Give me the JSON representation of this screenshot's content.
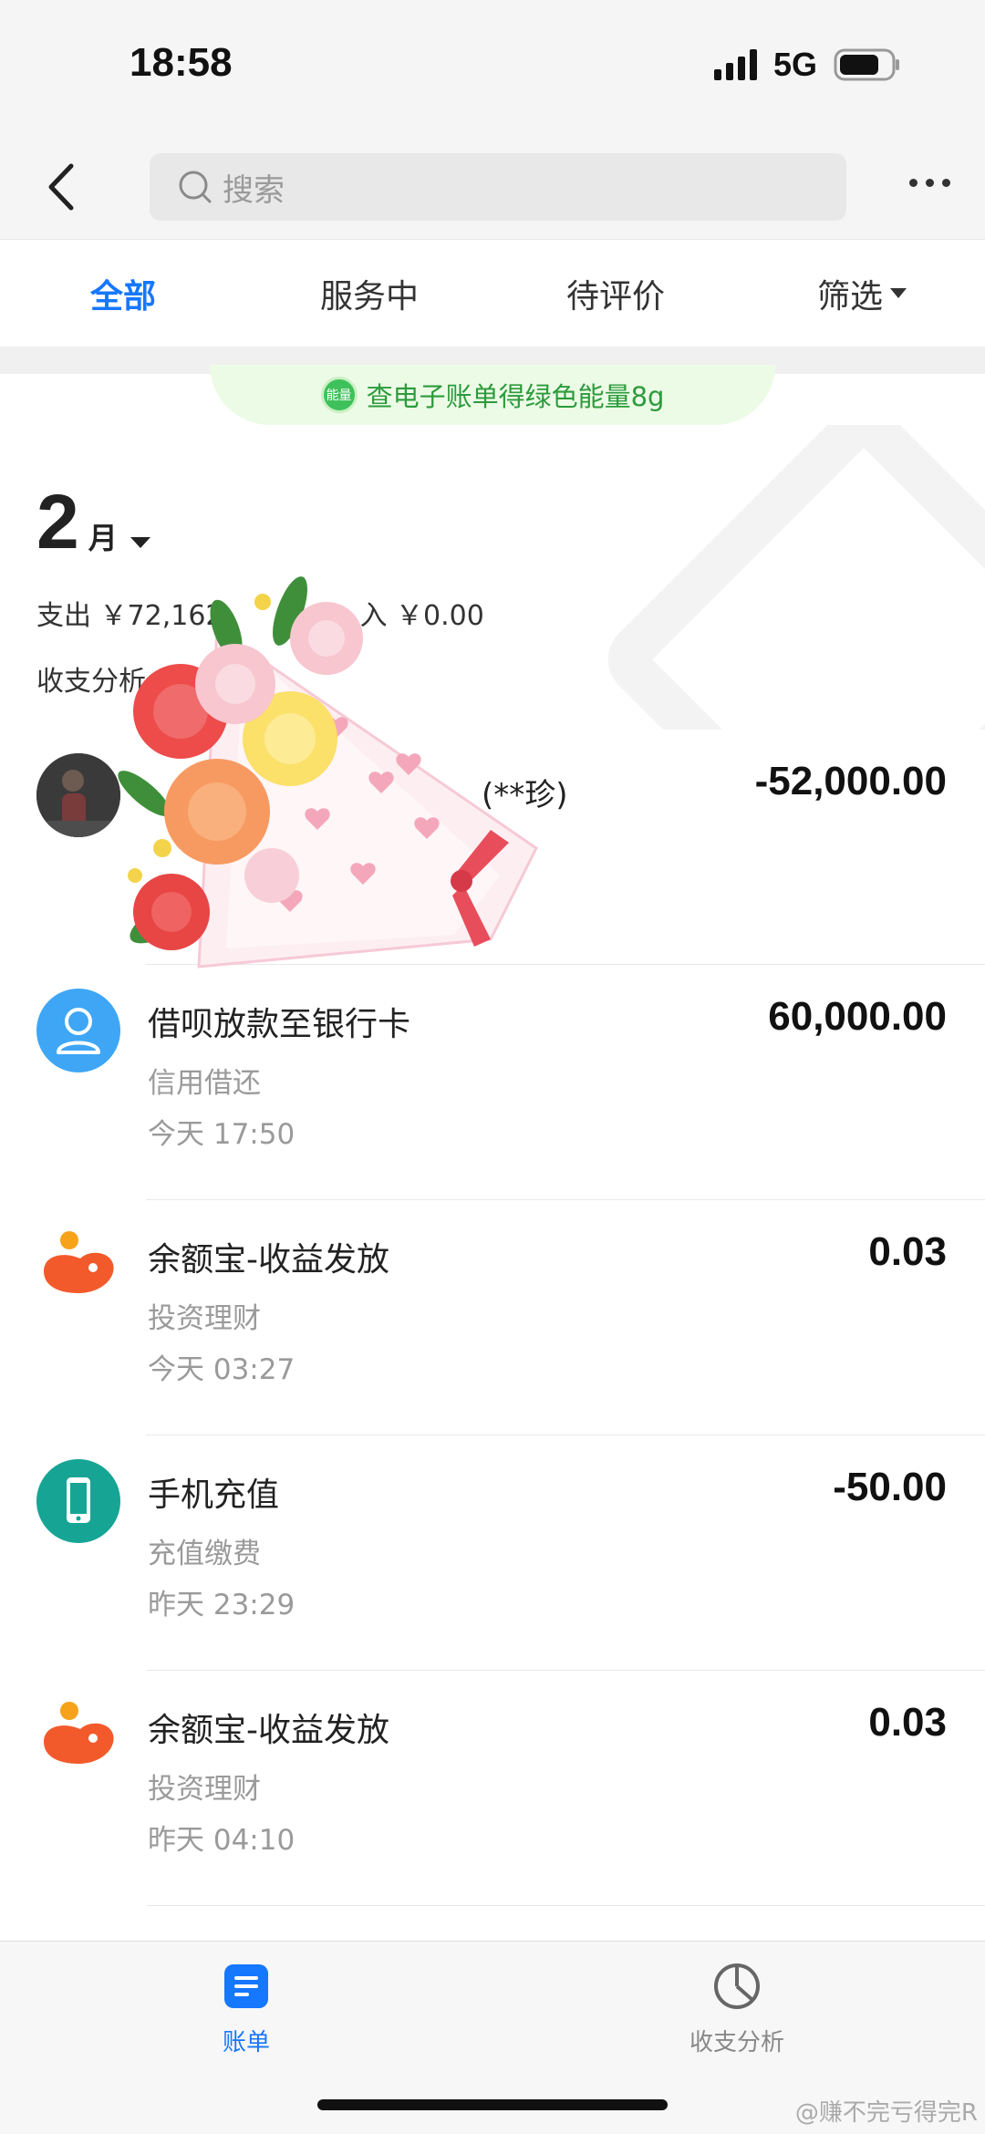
{
  "status_bar": {
    "time": "18:58",
    "network": "5G"
  },
  "header": {
    "search_placeholder": "搜索"
  },
  "tabs": [
    {
      "label": "全部",
      "active": true
    },
    {
      "label": "服务中",
      "active": false
    },
    {
      "label": "待评价",
      "active": false
    },
    {
      "label": "筛选",
      "active": false
    }
  ],
  "energy_banner": {
    "badge": "能量",
    "text": "查电子账单得绿色能量8g"
  },
  "summary": {
    "month": "2",
    "month_unit": "月",
    "expense_text": "支出 ￥72,162",
    "income_text": "入 ￥0.00",
    "analysis_label": "收支分析"
  },
  "transactions": [
    {
      "title": "(**珍)",
      "category": "",
      "time": "",
      "amount": "-52,000.00",
      "icon": "avatar-photo"
    },
    {
      "title": "借呗放款至银行卡",
      "category": "信用借还",
      "time": "今天  17:50",
      "amount": "60,000.00",
      "icon": "person-icon",
      "icon_color": "#3ea6f5"
    },
    {
      "title": "余额宝-收益发放",
      "category": "投资理财",
      "time": "今天  03:27",
      "amount": "0.03",
      "icon": "yuebao-icon",
      "icon_color": "#f35a2b"
    },
    {
      "title": "手机充值",
      "category": "充值缴费",
      "time": "昨天  23:29",
      "amount": "-50.00",
      "icon": "phone-icon",
      "icon_color": "#16a594"
    },
    {
      "title": "余额宝-收益发放",
      "category": "投资理财",
      "time": "昨天  04:10",
      "amount": "0.03",
      "icon": "yuebao-icon",
      "icon_color": "#f35a2b"
    }
  ],
  "bottom_nav": [
    {
      "label": "账单",
      "active": true,
      "icon": "bill-icon"
    },
    {
      "label": "收支分析",
      "active": false,
      "icon": "pie-chart-icon"
    }
  ],
  "watermark": "@赚不完亏得完R",
  "colors": {
    "accent": "#1677ff",
    "green": "#2c9b3c"
  }
}
